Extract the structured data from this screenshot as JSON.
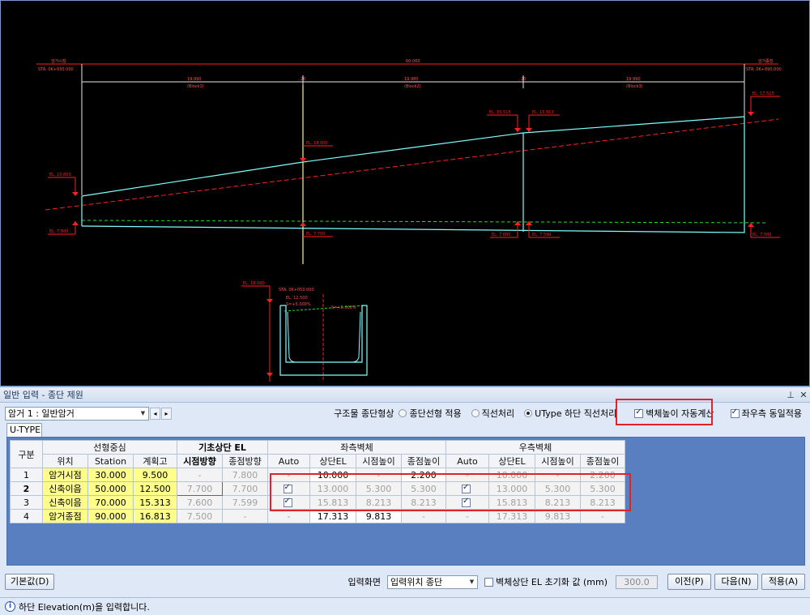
{
  "cad": {
    "label_start": "암거시점",
    "sta_start": "STA. 0K+030.000",
    "label_end": "암거종점",
    "sta_end": "STA. 0K+090.000",
    "total_len": "60.000",
    "seg1_len": "19.990",
    "seg1_name": "(Block1)",
    "seg2_len": "19.980",
    "seg2_name": "(Block2)",
    "seg3_len": "19.990",
    "seg3_name": "(Block3)",
    "joint1": "20",
    "joint2": "20",
    "el_10000": "EL. 10.000",
    "el_7800": "EL. 7.800",
    "el_18000": "EL. 18.000",
    "el_7700": "EL. 7.700",
    "el_15515": "EL. 15.515",
    "el_15813": "EL. 15.813",
    "el_7600": "EL. 7.600",
    "el_7599": "EL. 7.599",
    "el_17515": "EL. 17.515",
    "el_7500": "EL. 7.500",
    "sec_el18": "EL. 18.000",
    "sec_sta": "STA. 0K+050.000",
    "sec_el12": "EL. 12.500",
    "sec_slope_l": "S=+5.000%",
    "sec_slope_r": "S=+5.000%"
  },
  "panel": {
    "title": "일반 입력 - 종단 제원",
    "pin_icon": "pin-icon",
    "close_icon": "close-icon",
    "box_select": "암거 1 : 일반암거",
    "shape_label": "구조물 종단형상",
    "opt1": "종단선형 적용",
    "opt2": "직선처리",
    "opt3": "UType 하단 직선처리",
    "chk_wall_auto": "벽체높이 자동계산",
    "chk_same": "좌우측 동일적용",
    "tab": "U-TYPE"
  },
  "table": {
    "h_gubun": "구분",
    "h_center": "선형중심",
    "h_base": "기초상단 EL",
    "h_left": "좌측벽체",
    "h_right": "우측벽체",
    "h_pos": "위치",
    "h_station": "Station",
    "h_plan": "계획고",
    "h_start_dir": "시점방향",
    "h_end_dir": "종점방향",
    "h_auto": "Auto",
    "h_top_el": "상단EL",
    "h_start_h": "시점높이",
    "h_end_h": "종점높이",
    "rows": [
      {
        "no": "1",
        "pos": "암거시점",
        "sta": "30.000",
        "plan": "9.500",
        "bs": "-",
        "be": "7.800",
        "la": "-",
        "ltop": "10.000",
        "ls": "-",
        "le": "2.200",
        "ra": "-",
        "rtop": "10.000",
        "rs": "-",
        "re": "2.200"
      },
      {
        "no": "2",
        "pos": "신축이음",
        "sta": "50.000",
        "plan": "12.500",
        "bs": "7.700",
        "be": "7.700",
        "la": "",
        "ltop": "13.000",
        "ls": "5.300",
        "le": "5.300",
        "ra": "",
        "rtop": "13.000",
        "rs": "5.300",
        "re": "5.300"
      },
      {
        "no": "3",
        "pos": "신축이음",
        "sta": "70.000",
        "plan": "15.313",
        "bs": "7.600",
        "be": "7.599",
        "la": "",
        "ltop": "15.813",
        "ls": "8.213",
        "le": "8.213",
        "ra": "",
        "rtop": "15.813",
        "rs": "8.213",
        "re": "8.213"
      },
      {
        "no": "4",
        "pos": "암거종점",
        "sta": "90.000",
        "plan": "16.813",
        "bs": "7.500",
        "be": "-",
        "la": "-",
        "ltop": "17.313",
        "ls": "9.813",
        "le": "-",
        "ra": "-",
        "rtop": "17.313",
        "rs": "9.813",
        "re": "-"
      }
    ]
  },
  "bottom": {
    "default_btn": "기본값(D)",
    "input_screen_label": "입력화면",
    "input_screen_value": "입력위치 종단",
    "chk_reset": "벽체상단 EL 초기화 값 (mm)",
    "reset_value": "300.0",
    "prev_btn": "이전(P)",
    "next_btn": "다음(N)",
    "apply_btn": "적용(A)"
  },
  "status": {
    "text": "하단 Elevation(m)을 입력합니다."
  },
  "colors": {
    "cad_bg": "#000000",
    "line_cyan": "#7fffff",
    "line_red": "#ff2020",
    "line_green": "#22dd22",
    "line_yellow": "#ffff33",
    "highlight_red": "#e0232b"
  }
}
